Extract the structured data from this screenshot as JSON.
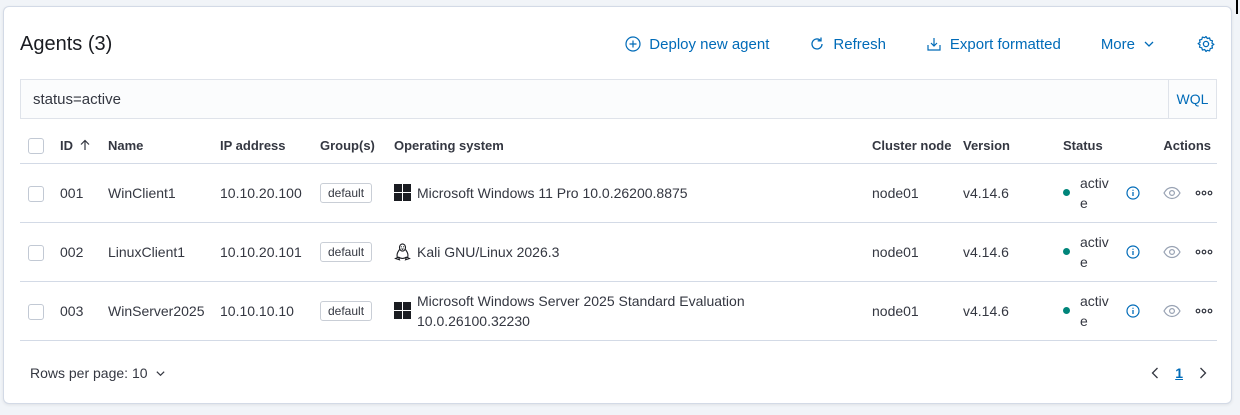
{
  "header": {
    "title": "Agents (3)",
    "deploy_label": "Deploy new agent",
    "refresh_label": "Refresh",
    "export_label": "Export formatted",
    "more_label": "More"
  },
  "search": {
    "value": "status=active",
    "wql_label": "WQL"
  },
  "table": {
    "columns": {
      "id": "ID",
      "name": "Name",
      "ip": "IP address",
      "groups": "Group(s)",
      "os": "Operating system",
      "node": "Cluster node",
      "version": "Version",
      "status": "Status",
      "actions": "Actions"
    },
    "rows": [
      {
        "id": "001",
        "name": "WinClient1",
        "ip": "10.10.20.100",
        "group": "default",
        "os_icon": "windows-icon",
        "os": "Microsoft Windows 11 Pro 10.0.26200.8875",
        "node": "node01",
        "version": "v4.14.6",
        "status": "active"
      },
      {
        "id": "002",
        "name": "LinuxClient1",
        "ip": "10.10.20.101",
        "group": "default",
        "os_icon": "linux-icon",
        "os": "Kali GNU/Linux 2026.3",
        "node": "node01",
        "version": "v4.14.6",
        "status": "active"
      },
      {
        "id": "003",
        "name": "WinServer2025",
        "ip": "10.10.10.10",
        "group": "default",
        "os_icon": "windows-icon",
        "os": "Microsoft Windows Server 2025 Standard Evaluation 10.0.26100.32230",
        "node": "node01",
        "version": "v4.14.6",
        "status": "active"
      }
    ]
  },
  "footer": {
    "rows_per_page_label": "Rows per page: 10",
    "current_page": "1"
  },
  "colors": {
    "accent": "#006bb8",
    "status_active": "#00857a",
    "border": "#d3dae6"
  }
}
